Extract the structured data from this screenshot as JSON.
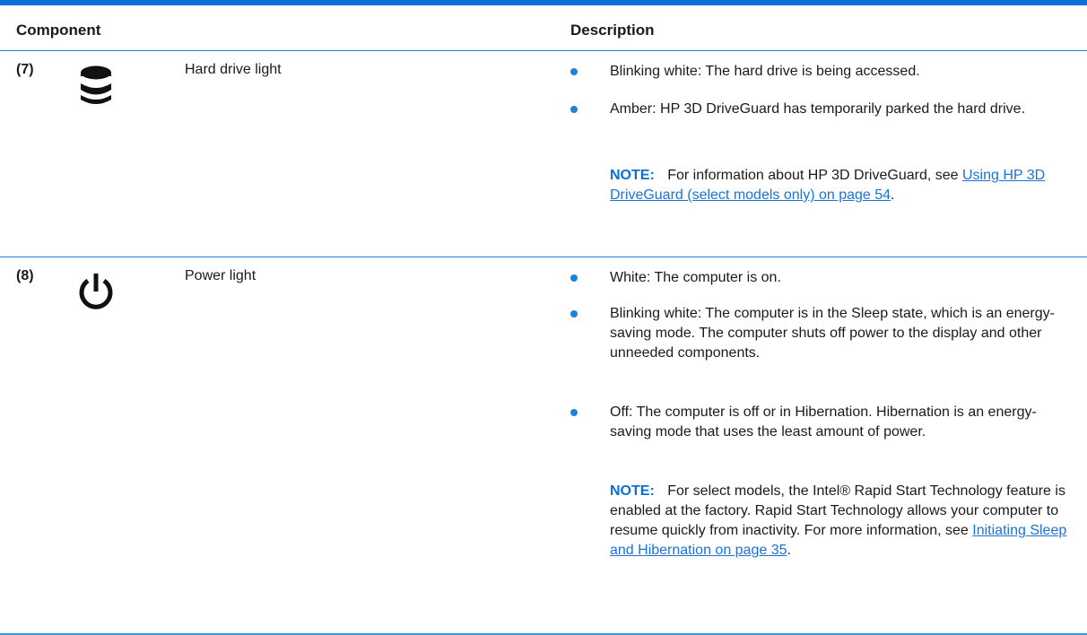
{
  "header": {
    "component": "Component",
    "description": "Description"
  },
  "rows": [
    {
      "number": "(7)",
      "icon": "hard-drive-icon",
      "name": "Hard drive light",
      "bullets": [
        "Blinking white: The hard drive is being accessed.",
        "Amber: HP 3D DriveGuard has temporarily parked the hard drive."
      ],
      "note": {
        "label": "NOTE:",
        "text": "For information about HP 3D DriveGuard, see",
        "link": "Using HP 3D DriveGuard (select models only) on page 54",
        "tail": "."
      }
    },
    {
      "number": "(8)",
      "icon": "power-icon",
      "name": "Power light",
      "bullets": [
        "White: The computer is on.",
        "Blinking white: The computer is in the Sleep state, which is an energy-saving mode. The computer shuts off power to the display and other unneeded components.",
        "Off: The computer is off or in Hibernation. Hibernation is an energy-saving mode that uses the least amount of power."
      ],
      "note": {
        "label": "NOTE:",
        "text": "For select models, the Intel® Rapid Start Technology feature is enabled at the factory. Rapid Start Technology allows your computer to resume quickly from inactivity. For more information, see",
        "link": "Initiating Sleep and Hibernation on page 35",
        "tail": "."
      }
    }
  ],
  "colors": {
    "accent": "#0b6fd6",
    "rule": "#1f82d6",
    "link": "#1a73d9"
  }
}
